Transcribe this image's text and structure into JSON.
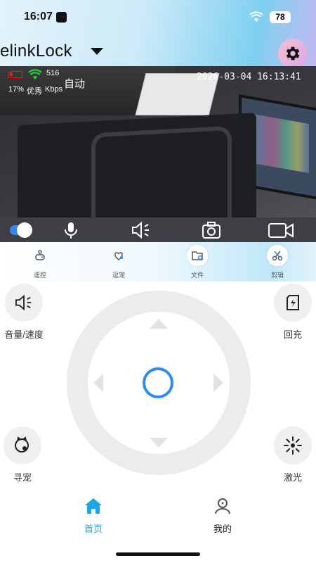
{
  "status_bar": {
    "time": "16:07",
    "battery": "78"
  },
  "header": {
    "device_name": "elinkLock"
  },
  "video": {
    "hud": {
      "battery_percent": "17%",
      "quality": "优秀",
      "rate": "516",
      "rate_unit": "Kbps",
      "mode": "自动",
      "timestamp": "2026-03-04 16:13:41"
    }
  },
  "func_tabs": [
    {
      "label": "遥控",
      "icon": "remote-icon"
    },
    {
      "label": "逗宠",
      "icon": "pet-play-icon"
    },
    {
      "label": "文件",
      "icon": "file-icon"
    },
    {
      "label": "剪辑",
      "icon": "scissors-icon"
    }
  ],
  "controls": {
    "volume_speed": "音量/速度",
    "recharge": "回充",
    "find_pet": "寻宠",
    "laser": "激光"
  },
  "nav": {
    "home": "首页",
    "mine": "我的"
  },
  "colors": {
    "accent": "#2d8cf0",
    "nav_active": "#1aa7e8"
  }
}
